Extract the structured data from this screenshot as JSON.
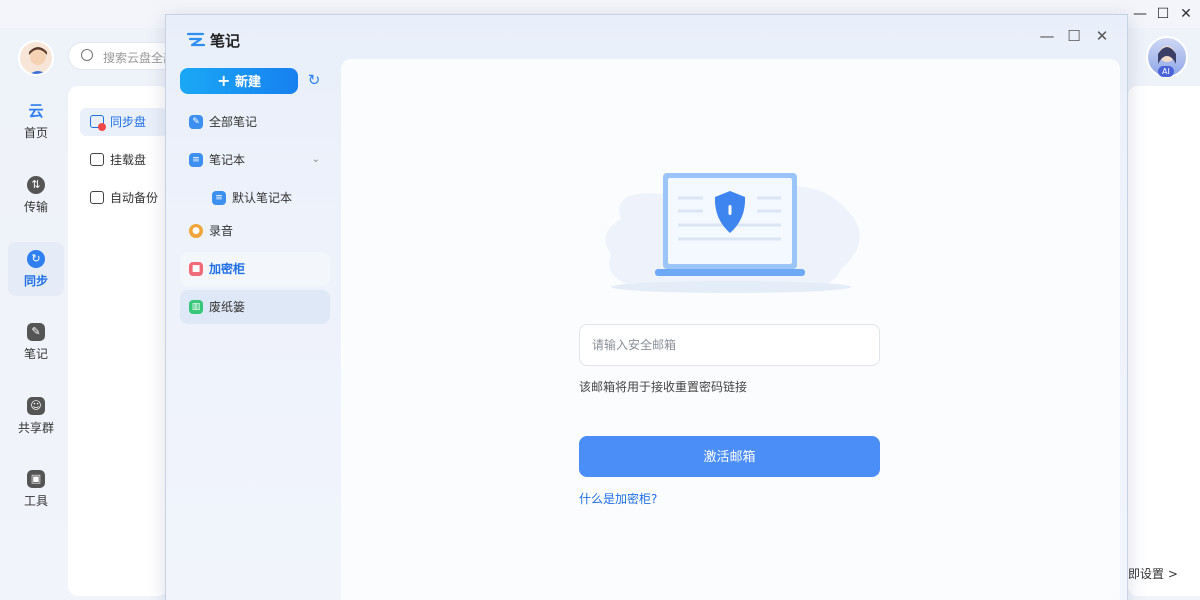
{
  "background_app": {
    "search_placeholder": "搜索云盘全部",
    "nav": [
      {
        "label": "首页",
        "icon": "cloud-logo-icon"
      },
      {
        "label": "传输",
        "icon": "transfer-icon"
      },
      {
        "label": "同步",
        "icon": "sync-icon",
        "active": true
      },
      {
        "label": "笔记",
        "icon": "note-icon"
      },
      {
        "label": "共享群",
        "icon": "share-group-icon"
      },
      {
        "label": "工具",
        "icon": "tools-icon"
      }
    ],
    "sub_nav": [
      {
        "label": "同步盘",
        "active": true
      },
      {
        "label": "挂载盘"
      },
      {
        "label": "自动备份"
      }
    ],
    "ai_badge": "AI",
    "settings_link": "即设置 >"
  },
  "notes_window": {
    "title": "笔记",
    "new_button": "新建",
    "sidebar": [
      {
        "label": "全部笔记",
        "icon": "all-notes-icon",
        "color": "#3d8ff0"
      },
      {
        "label": "笔记本",
        "icon": "notebook-icon",
        "color": "#3d8ff0",
        "expandable": true
      },
      {
        "label": "默认笔记本",
        "icon": "notebook-icon",
        "color": "#3d8ff0",
        "indent": true
      },
      {
        "label": "录音",
        "icon": "record-icon",
        "color": "#f0a53a"
      },
      {
        "label": "加密柜",
        "icon": "lock-icon",
        "color": "#f06a78",
        "state": "active"
      },
      {
        "label": "废纸篓",
        "icon": "trash-icon",
        "color": "#38c77a",
        "state": "selected"
      }
    ],
    "locker": {
      "email_placeholder": "请输入安全邮箱",
      "email_value": "",
      "hint": "该邮箱将用于接收重置密码链接",
      "activate_button": "激活邮箱",
      "what_link": "什么是加密柜?"
    }
  },
  "colors": {
    "accent": "#1f6fe6",
    "button": "#4b8ef7"
  }
}
